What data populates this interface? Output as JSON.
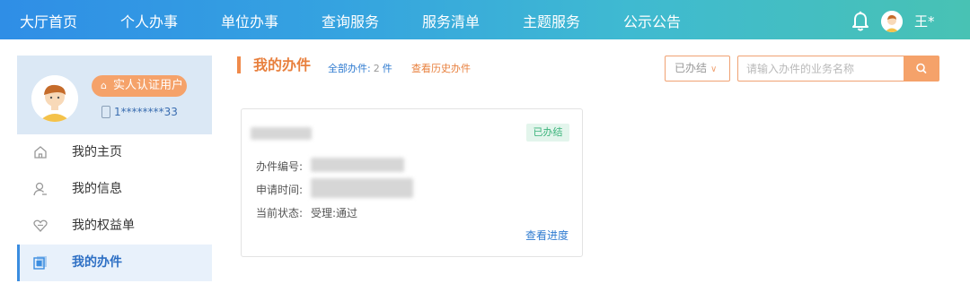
{
  "nav": {
    "items": [
      {
        "label": "大厅首页"
      },
      {
        "label": "个人办事"
      },
      {
        "label": "单位办事"
      },
      {
        "label": "查询服务"
      },
      {
        "label": "服务清单"
      },
      {
        "label": "主题服务"
      },
      {
        "label": "公示公告"
      }
    ],
    "user_name": "王*",
    "bell_icon": "bell-icon"
  },
  "sidebar": {
    "verify_badge": "实人认证用户",
    "phone": "1********33",
    "items": [
      {
        "label": "我的主页",
        "icon": "home-icon"
      },
      {
        "label": "我的信息",
        "icon": "user-icon"
      },
      {
        "label": "我的权益单",
        "icon": "heart-shield-icon"
      },
      {
        "label": "我的办件",
        "icon": "document-stack-icon",
        "active": true
      }
    ]
  },
  "main": {
    "title": "我的办件",
    "total_label": "全部办件:",
    "total_count": "2",
    "total_unit": "件",
    "history_link": "查看历史办件",
    "status_filter": "已办结",
    "search_placeholder": "请输入办件的业务名称"
  },
  "card": {
    "status": "已办结",
    "fields": [
      {
        "label": "办件编号:",
        "value": ""
      },
      {
        "label": "申请时间:",
        "value": ""
      },
      {
        "label": "当前状态:",
        "value": "受理:通过"
      }
    ],
    "link": "查看进度"
  },
  "colors": {
    "accent_orange": "#f08a4b",
    "link_blue": "#2f7bd0",
    "active_bg": "#e8f1fb",
    "status_green": "#3ab37a"
  }
}
